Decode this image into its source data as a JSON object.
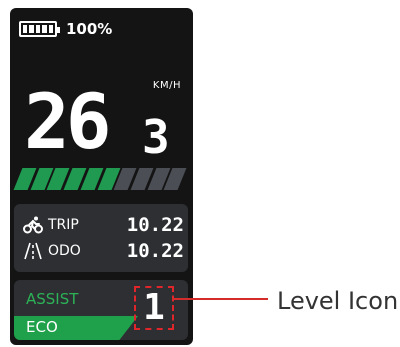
{
  "status": {
    "battery_percent": 100,
    "battery_text": "100%",
    "battery_icon": "battery-full-icon"
  },
  "speed": {
    "whole": "26",
    "decimal": "3",
    "unit": "KM/H"
  },
  "assist_gauge": {
    "total_segments": 10,
    "active_segments": 6,
    "active_color": "#1f9a50",
    "inactive_color": "#4b4e55"
  },
  "trip": {
    "icon": "cyclist-icon",
    "label": "TRIP",
    "value": "10.22"
  },
  "odo": {
    "icon": "road-icon",
    "label": "ODO",
    "value": "10.22"
  },
  "assist": {
    "label": "ASSIST",
    "mode": "ECO",
    "level": "1",
    "label_color": "#2db257",
    "mode_color": "#1fa04a"
  },
  "callout": {
    "label": "Level Icon",
    "color": "#d42b2b"
  }
}
